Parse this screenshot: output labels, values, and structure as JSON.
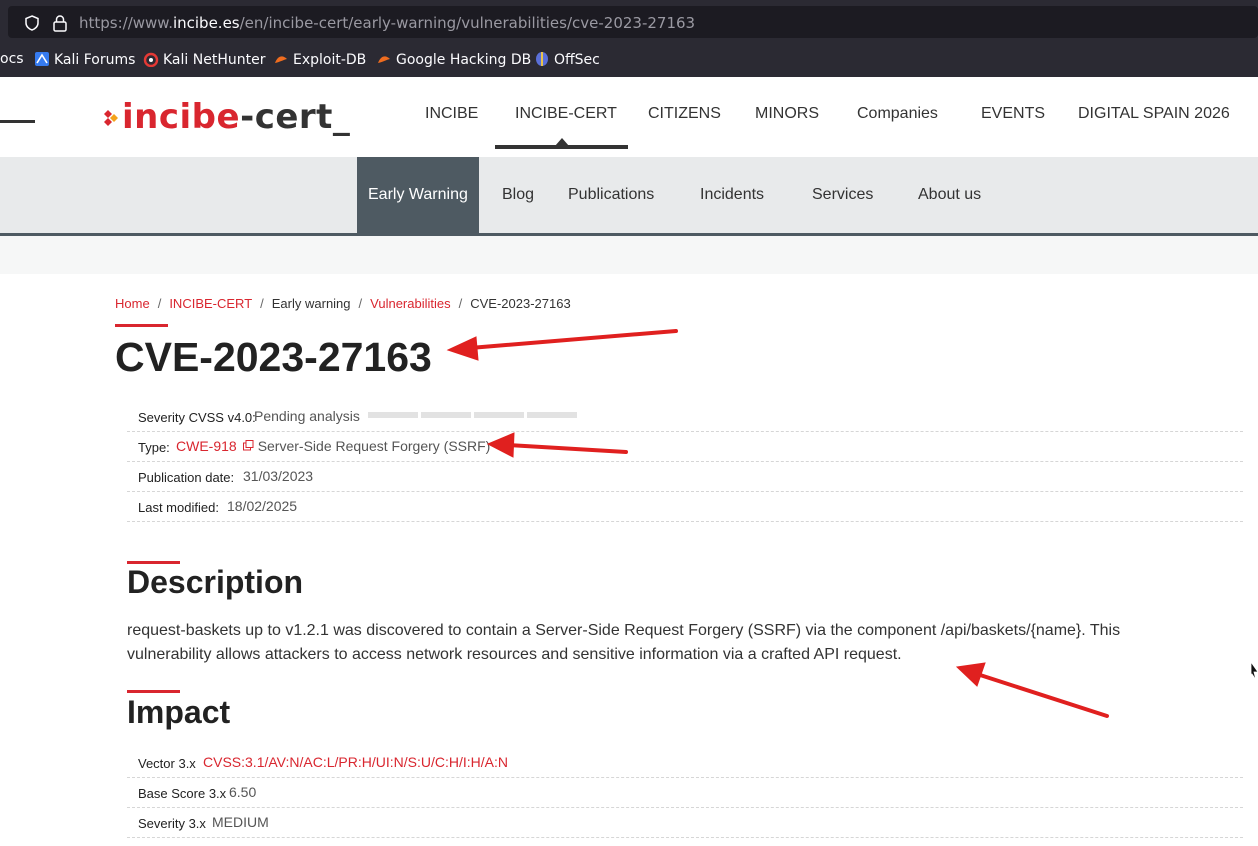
{
  "browser": {
    "url_prefix": "https://www.",
    "url_domain": "incibe.es",
    "url_path": "/en/incibe-cert/early-warning/vulnerabilities/cve-2023-27163",
    "bookmarks": [
      {
        "label": "ocs",
        "icon": "none"
      },
      {
        "label": "Kali Forums",
        "icon": "kali-forums-icon"
      },
      {
        "label": "Kali NetHunter",
        "icon": "kali-nethunter-icon"
      },
      {
        "label": "Exploit-DB",
        "icon": "exploit-db-icon"
      },
      {
        "label": "Google Hacking DB",
        "icon": "google-hacking-db-icon"
      },
      {
        "label": "OffSec",
        "icon": "offsec-icon"
      }
    ]
  },
  "header": {
    "logo_main": "incibe",
    "logo_suffix": "-cert_",
    "nav": [
      "INCIBE",
      "INCIBE-CERT",
      "CITIZENS",
      "MINORS",
      "Companies",
      "EVENTS",
      "DIGITAL SPAIN 2026"
    ],
    "active_nav": "INCIBE-CERT"
  },
  "subnav": {
    "items": [
      "Early Warning",
      "Blog",
      "Publications",
      "Incidents",
      "Services",
      "About us"
    ],
    "active": "Early Warning"
  },
  "breadcrumb": {
    "home": "Home",
    "incibe_cert": "INCIBE-CERT",
    "early_warning": "Early warning",
    "vulnerabilities": "Vulnerabilities",
    "current": "CVE-2023-27163",
    "separator": "/"
  },
  "page": {
    "title": "CVE-2023-27163",
    "severity_label": "Severity CVSS v4.0:",
    "severity_value": "Pending analysis",
    "type_label": "Type:",
    "type_cwe": "CWE-918",
    "type_name": "Server-Side Request Forgery (SSRF)",
    "pub_label": "Publication date:",
    "pub_value": "31/03/2023",
    "mod_label": "Last modified:",
    "mod_value": "18/02/2025"
  },
  "description": {
    "heading": "Description",
    "text": "request-baskets up to v1.2.1 was discovered to contain a Server-Side Request Forgery (SSRF) via the component /api/baskets/{name}. This vulnerability allows attackers to access network resources and sensitive information via a crafted API request."
  },
  "impact": {
    "heading": "Impact",
    "vector_label": "Vector 3.x",
    "vector_value": "CVSS:3.1/AV:N/AC:L/PR:H/UI:N/S:U/C:H/I:H/A:N",
    "score_label": "Base Score 3.x",
    "score_value": "6.50",
    "severity_label": "Severity 3.x",
    "severity_value": "MEDIUM"
  },
  "colors": {
    "accent": "#d9262f",
    "subnav_active": "#4e5a62",
    "annotation_arrow": "#e0201f"
  }
}
